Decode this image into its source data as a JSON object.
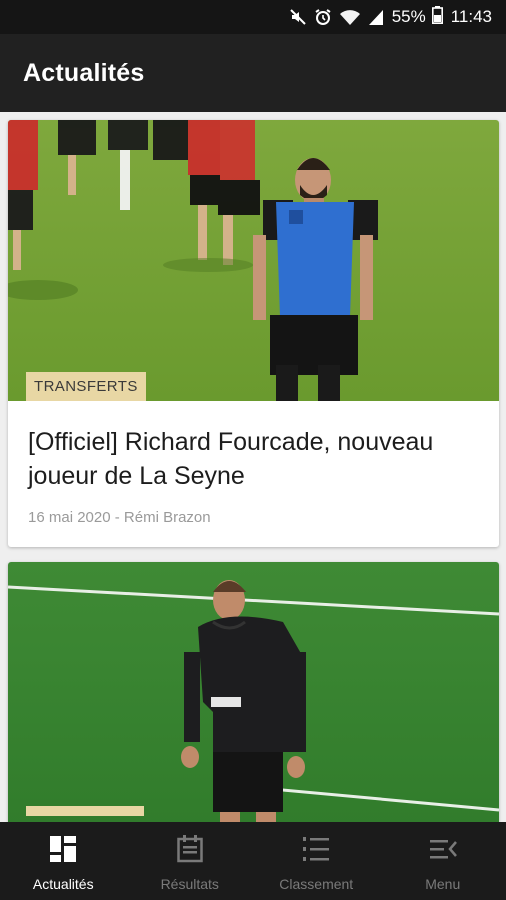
{
  "status_bar": {
    "icons": [
      "mute-icon",
      "alarm-icon",
      "wifi-icon",
      "signal-icon",
      "battery-icon"
    ],
    "battery": "55%",
    "time": "11:43"
  },
  "app_bar": {
    "title": "Actualités"
  },
  "articles": [
    {
      "category": "TRANSFERTS",
      "title": "[Officiel] Richard Fourcade, nouveau joueur de La Seyne",
      "date": "16 mai 2020",
      "separator": "-",
      "author": "Rémi Brazon"
    }
  ],
  "bottom_nav": [
    {
      "label": "Actualités",
      "icon": "news-grid-icon",
      "active": true
    },
    {
      "label": "Résultats",
      "icon": "calendar-icon",
      "active": false
    },
    {
      "label": "Classement",
      "icon": "ranking-list-icon",
      "active": false
    },
    {
      "label": "Menu",
      "icon": "menu-icon",
      "active": false
    }
  ],
  "colors": {
    "app_bar": "#212121",
    "badge": "#e8d7a4",
    "nav_active": "#ffffff",
    "nav_inactive": "#7a7a7a"
  }
}
